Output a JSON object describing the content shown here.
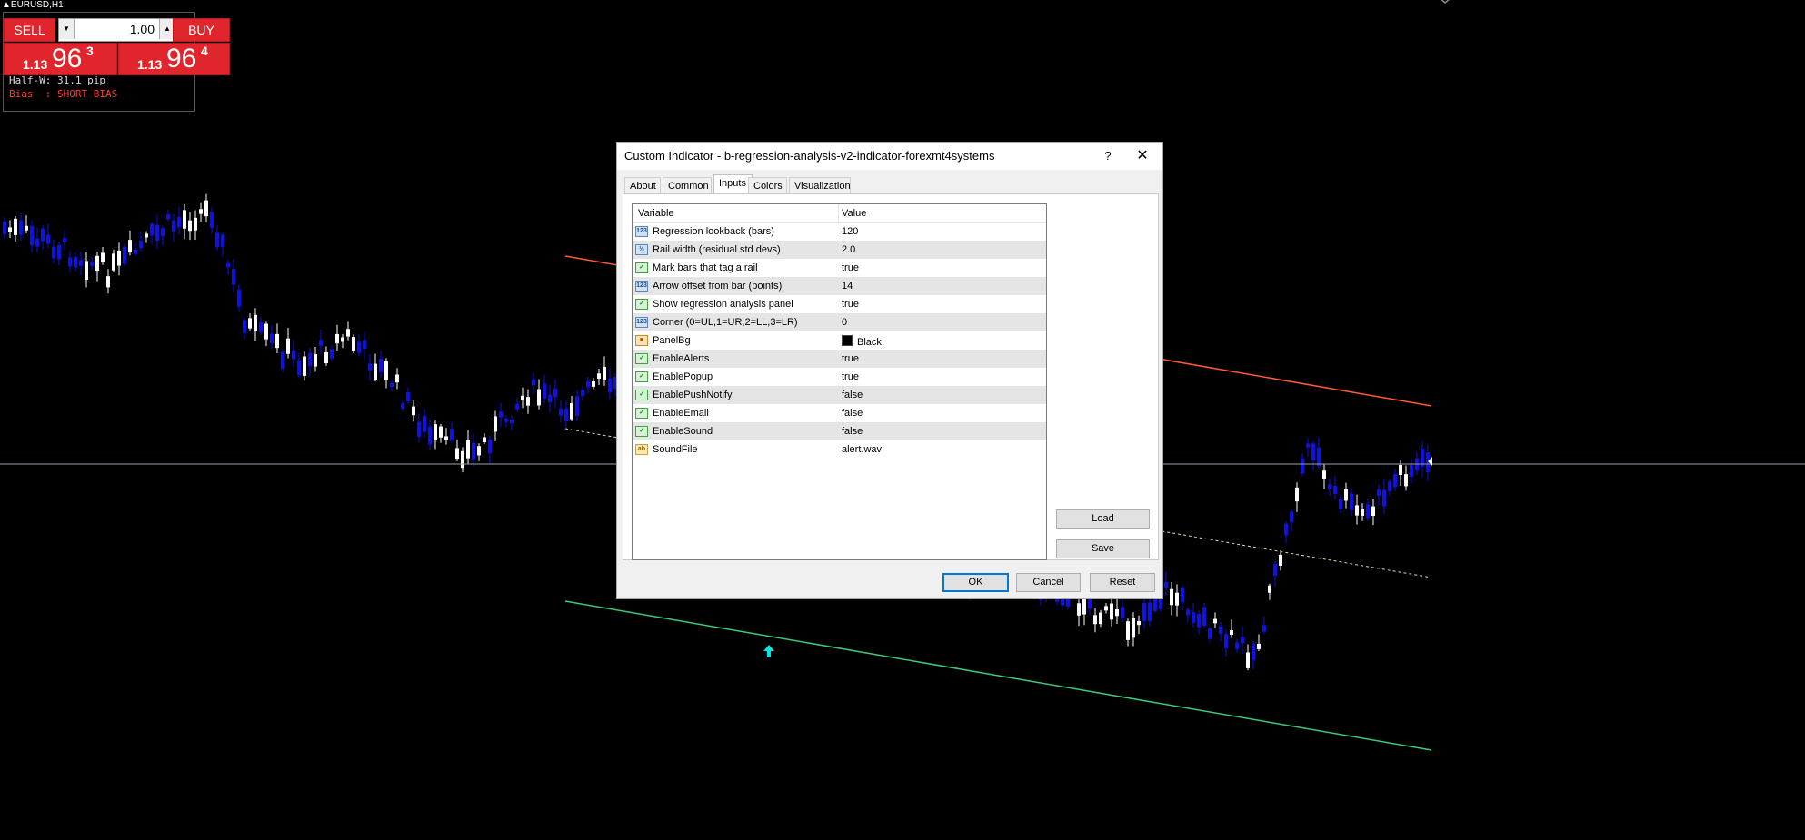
{
  "window": {
    "symbol": "EURUSD,H1"
  },
  "trade_panel": {
    "sell_label": "SELL",
    "buy_label": "BUY",
    "lot_value": "1.00",
    "lot_down_icon": "down-triangle",
    "lot_up_icon": "up-triangle",
    "sell_price": {
      "prefix": "1.13",
      "big": "96",
      "sup": "3"
    },
    "buy_price": {
      "prefix": "1.13",
      "big": "96",
      "sup": "4"
    },
    "half_width_text": "Half-W: 31.1 pip",
    "bias_text": "Bias  : SHORT BIAS",
    "accent_color": "#e0262c",
    "bias_color": "#ff3b30"
  },
  "chart": {
    "colors": {
      "bull": "#ffffff",
      "bear": "#1010e8",
      "upper_rail": "#ff5a36",
      "lower_rail": "#3dc97a",
      "midline": "#e8d8a8",
      "arrow": "#00e5e5"
    },
    "arrow_icon": "up-arrow"
  },
  "dialog": {
    "title": "Custom Indicator - b-regression-analysis-v2-indicator-forexmt4systems",
    "help_label": "?",
    "close_label": "✕",
    "tabs": [
      {
        "label": "About"
      },
      {
        "label": "Common"
      },
      {
        "label": "Inputs"
      },
      {
        "label": "Colors"
      },
      {
        "label": "Visualization"
      }
    ],
    "active_tab": "Inputs",
    "grid": {
      "headers": {
        "variable": "Variable",
        "value": "Value"
      },
      "rows": [
        {
          "name": "Regression lookback (bars)",
          "value": "120",
          "icon": "123"
        },
        {
          "name": "Rail width (residual std devs)",
          "value": "2.0",
          "icon": "½"
        },
        {
          "name": "Mark bars that tag a rail",
          "value": "true",
          "icon": "bool"
        },
        {
          "name": "Arrow offset from bar (points)",
          "value": "14",
          "icon": "123"
        },
        {
          "name": "Show regression analysis panel",
          "value": "true",
          "icon": "bool"
        },
        {
          "name": "Corner (0=UL,1=UR,2=LL,3=LR)",
          "value": "0",
          "icon": "123"
        },
        {
          "name": "PanelBg",
          "value": "Black",
          "icon": "color"
        },
        {
          "name": "EnableAlerts",
          "value": "true",
          "icon": "bool"
        },
        {
          "name": "EnablePopup",
          "value": "true",
          "icon": "bool"
        },
        {
          "name": "EnablePushNotify",
          "value": "false",
          "icon": "bool"
        },
        {
          "name": "EnableEmail",
          "value": "false",
          "icon": "bool"
        },
        {
          "name": "EnableSound",
          "value": "false",
          "icon": "bool"
        },
        {
          "name": "SoundFile",
          "value": "alert.wav",
          "icon": "ab"
        }
      ]
    },
    "buttons": {
      "load": "Load",
      "save": "Save",
      "ok": "OK",
      "cancel": "Cancel",
      "reset": "Reset"
    }
  }
}
